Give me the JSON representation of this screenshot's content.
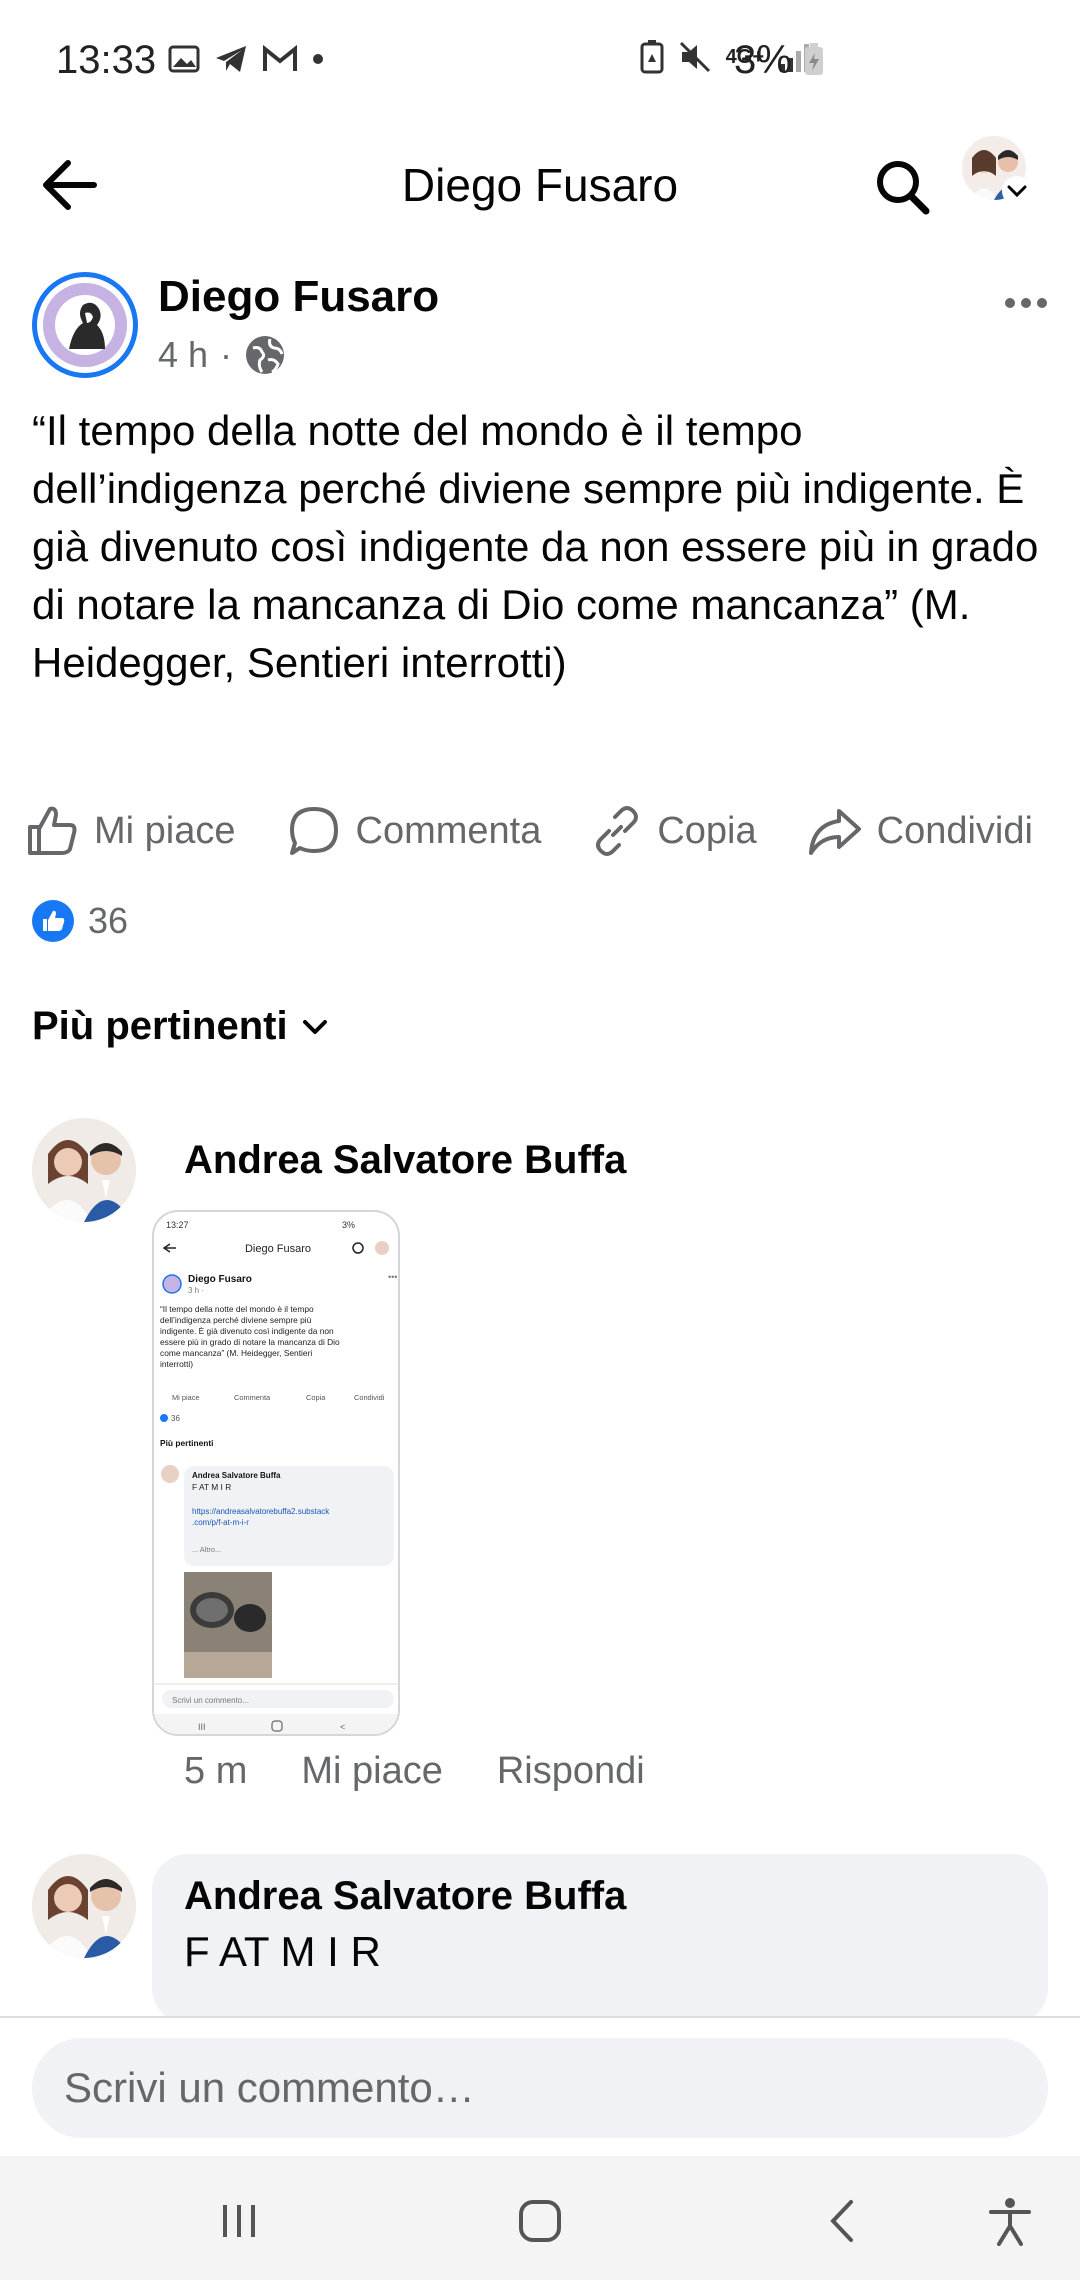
{
  "status_bar": {
    "time": "13:33",
    "network": "4G+",
    "battery": "3%",
    "icons": [
      "gallery-icon",
      "telegram-icon",
      "gmail-icon",
      "dot-icon",
      "battery-saver-icon",
      "mute-icon",
      "signal-icon",
      "battery-icon"
    ]
  },
  "header": {
    "title": "Diego Fusaro"
  },
  "post": {
    "author": "Diego Fusaro",
    "time": "4 h",
    "separator": "·",
    "text": "“Il tempo della notte del mondo è il tempo dell’indigenza perché diviene sempre più indigente. È già divenuto così indigente da non essere più in grado di notare la mancanza di Dio come mancanza” (M. Heidegger, Sentieri interrotti)",
    "actions": {
      "like": "Mi piace",
      "comment": "Commenta",
      "copy": "Copia",
      "share": "Condividi"
    },
    "reactions_count": "36"
  },
  "sort": {
    "label": "Più pertinenti"
  },
  "comments": [
    {
      "author": "Andrea Salvatore Buffa",
      "time": "5 m",
      "like": "Mi piace",
      "reply": "Rispondi"
    },
    {
      "author": "Andrea Salvatore Buffa",
      "text": "F AT M I R"
    }
  ],
  "thumbnail": {
    "time": "13:27",
    "battery": "3%",
    "title": "Diego Fusaro",
    "author": "Diego Fusaro",
    "meta": "3 h ·",
    "lines": [
      "“Il tempo della notte del mondo è il tempo",
      "dell’indigenza perché diviene sempre più",
      "indigente. È già divenuto così indigente da non",
      "essere più in grado di notare la mancanza di Dio",
      "come mancanza” (M. Heidegger, Sentieri",
      "interrotti)"
    ],
    "actions": [
      "Mi piace",
      "Commenta",
      "Copia",
      "Condividi"
    ],
    "count": "36",
    "sort": "Più pertinenti",
    "comment_author": "Andrea Salvatore Buffa",
    "comment_text": "F AT M I R",
    "link1": "https://andreasalvatorebuffa2.substack",
    "link2": ".com/p/f-at-m-i-r",
    "more": "... Altro...",
    "input": "Scrivi un commento..."
  },
  "comment_bar": {
    "placeholder": "Scrivi un commento…"
  },
  "colors": {
    "accent": "#1877f2",
    "secondary_text": "#65676b",
    "bubble": "#f0f2f5"
  }
}
